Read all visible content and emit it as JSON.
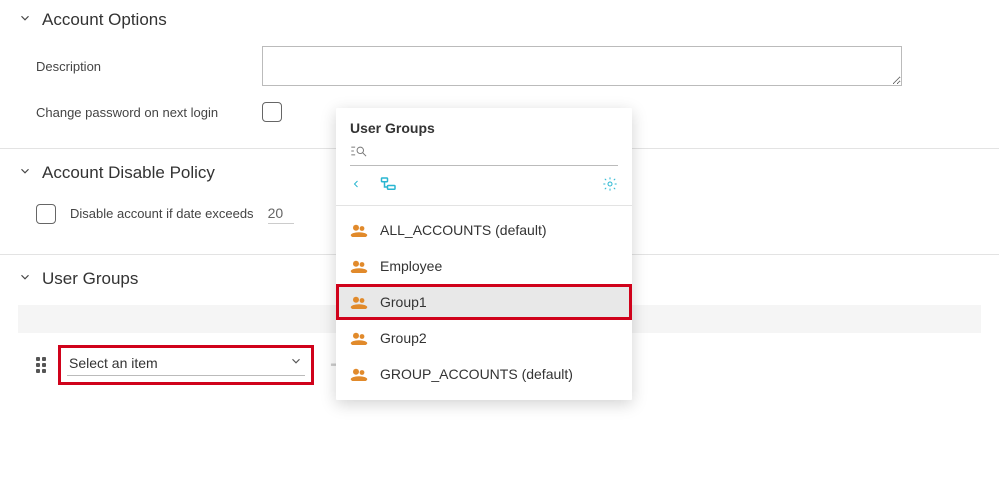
{
  "sections": {
    "account_options": {
      "title": "Account Options",
      "description_label": "Description",
      "description_value": "",
      "change_pw_label": "Change password on next login",
      "change_pw_checked": false
    },
    "account_disable_policy": {
      "title": "Account Disable Policy",
      "disable_label": "Disable account if date exceeds",
      "date_value": "20",
      "disable_checked": false
    },
    "user_groups": {
      "title": "User Groups",
      "select_placeholder": "Select an item"
    }
  },
  "popup": {
    "title": "User Groups",
    "items": [
      {
        "label": "ALL_ACCOUNTS (default)"
      },
      {
        "label": "Employee"
      },
      {
        "label": "Group1"
      },
      {
        "label": "Group2"
      },
      {
        "label": "GROUP_ACCOUNTS (default)"
      }
    ],
    "selected_index": 2
  }
}
